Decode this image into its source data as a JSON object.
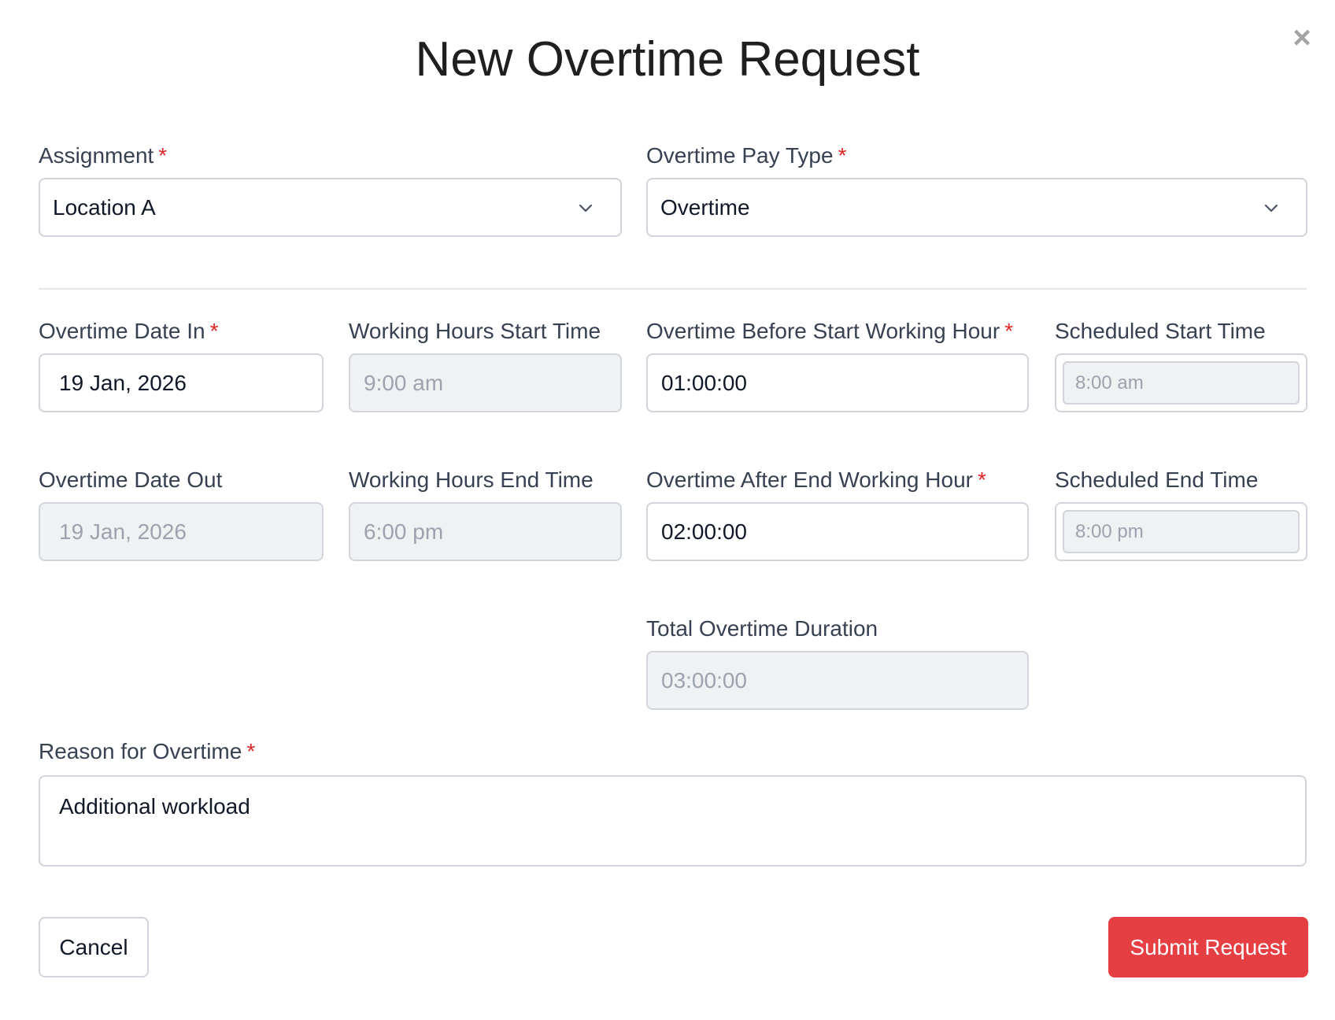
{
  "dialog": {
    "title": "New Overtime Request",
    "close_glyph": "×"
  },
  "required_marker": "*",
  "assignment": {
    "label": "Assignment",
    "value": "Location A"
  },
  "pay_type": {
    "label": "Overtime Pay Type",
    "value": "Overtime"
  },
  "date_in": {
    "label": "Overtime Date In",
    "value": "19 Jan, 2026"
  },
  "work_start": {
    "label": "Working Hours Start Time",
    "value": "9:00 am"
  },
  "ot_before": {
    "label": "Overtime Before Start Working Hour",
    "value": "01:00:00"
  },
  "sched_start": {
    "label": "Scheduled Start Time",
    "value": "8:00 am"
  },
  "date_out": {
    "label": "Overtime Date Out",
    "value": "19 Jan, 2026"
  },
  "work_end": {
    "label": "Working Hours End Time",
    "value": "6:00 pm"
  },
  "ot_after": {
    "label": "Overtime After End Working Hour",
    "value": "02:00:00"
  },
  "sched_end": {
    "label": "Scheduled End Time",
    "value": "8:00 pm"
  },
  "total": {
    "label": "Total Overtime Duration",
    "value": "03:00:00"
  },
  "reason": {
    "label": "Reason for Overtime",
    "value": "Additional workload"
  },
  "buttons": {
    "cancel": "Cancel",
    "submit": "Submit Request"
  },
  "colors": {
    "required": "#dc2626",
    "submit_bg": "#e53e43",
    "disabled_bg": "#f0f1f3"
  },
  "icons": {
    "close": "close-icon",
    "dropdown": "chevron-down-icon"
  }
}
